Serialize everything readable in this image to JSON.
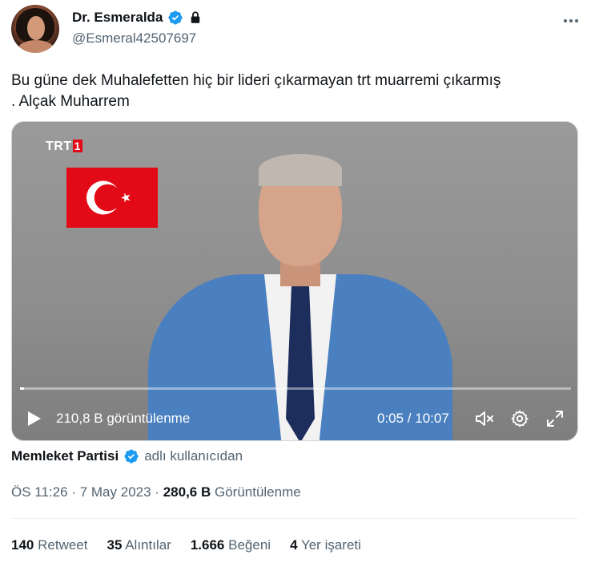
{
  "author": {
    "display_name": "Dr. Esmeralda",
    "handle": "@Esmeral42507697",
    "verified_icon": "verified-badge-icon",
    "lock_icon": "lock-icon"
  },
  "tweet": {
    "text_line1": "Bu güne dek Muhalefetten hiç bir lideri çıkarmayan trt muarremi çıkarmış",
    "text_line2": ". Alçak Muharrem"
  },
  "video": {
    "channel_logo": "TRT",
    "channel_logo_num": "1",
    "views_label": "210,8 B görüntülenme",
    "time_label": "0:05 / 10:07",
    "progress_fraction": 0.0079,
    "icons": [
      "play-icon",
      "mute-icon",
      "gear-icon",
      "fullscreen-icon"
    ]
  },
  "attribution": {
    "source": "Memleket Partisi",
    "suffix": "adlı kullanıcıdan"
  },
  "meta": {
    "time": "ÖS 11:26",
    "sep1": "·",
    "date": "7 May 2023",
    "sep2": "·",
    "views": "280,6 B",
    "views_label": "Görüntülenme"
  },
  "stats": [
    {
      "num": "140",
      "label": "Retweet"
    },
    {
      "num": "35",
      "label": "Alıntılar"
    },
    {
      "num": "1.666",
      "label": "Beğeni"
    },
    {
      "num": "4",
      "label": "Yer işareti"
    }
  ],
  "colors": {
    "verified_blue": "#1d9bf0",
    "secondary_text": "#536471",
    "flag_red": "#e30a17"
  }
}
